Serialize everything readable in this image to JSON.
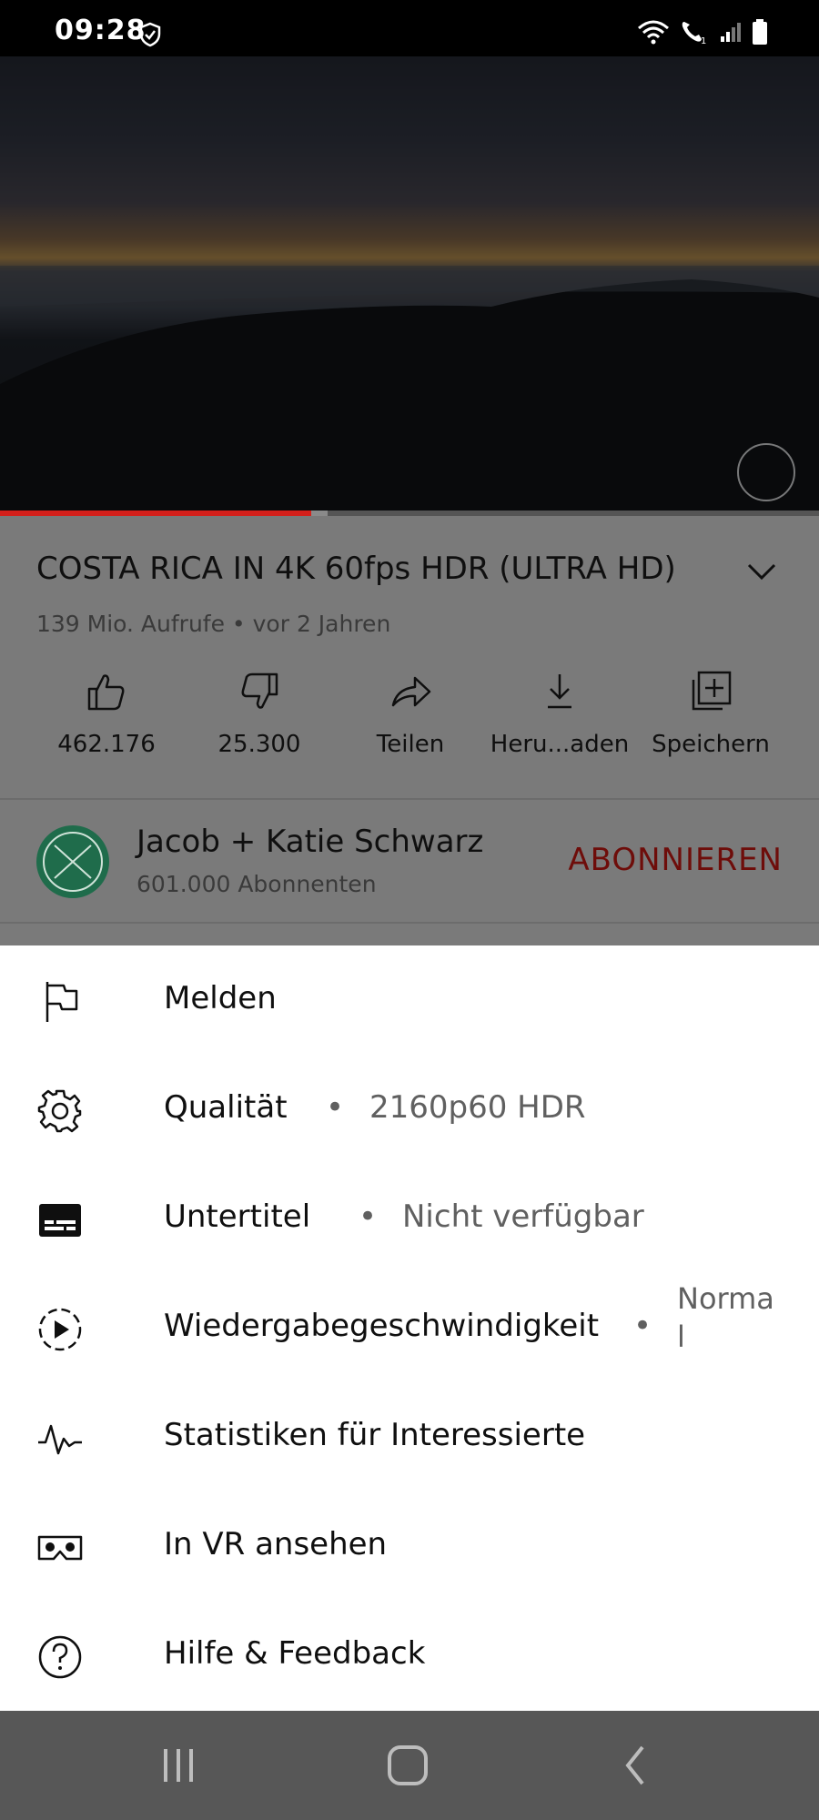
{
  "status_bar": {
    "time": "09:28"
  },
  "video": {
    "progress_played_fraction": 0.38
  },
  "info": {
    "title": "COSTA RICA IN 4K 60fps HDR (ULTRA HD)",
    "meta": "139 Mio. Aufrufe • vor 2 Jahren",
    "actions": [
      {
        "icon": "thumbs-up-icon",
        "label": "462.176"
      },
      {
        "icon": "thumbs-down-icon",
        "label": "25.300"
      },
      {
        "icon": "share-icon",
        "label": "Teilen"
      },
      {
        "icon": "download-icon",
        "label": "Heru...aden"
      },
      {
        "icon": "save-playlist-icon",
        "label": "Speichern"
      }
    ],
    "channel": {
      "name": "Jacob + Katie Schwarz",
      "subscribers": "601.000 Abonnenten",
      "subscribe_label": "ABONNIEREN"
    }
  },
  "menu": [
    {
      "icon": "flag-icon",
      "label": "Melden"
    },
    {
      "icon": "gear-icon",
      "label": "Qualität",
      "separator": "•",
      "value": "2160p60 HDR"
    },
    {
      "icon": "subtitles-icon",
      "label": "Untertitel",
      "separator": "•",
      "value": "Nicht verfügbar"
    },
    {
      "icon": "playback-speed-icon",
      "label": "Wiedergabegeschwindigkeit",
      "separator": "•",
      "value": "Normal"
    },
    {
      "icon": "stats-icon",
      "label": "Statistiken für Interessierte"
    },
    {
      "icon": "vr-headset-icon",
      "label": "In VR ansehen"
    },
    {
      "icon": "help-icon",
      "label": "Hilfe & Feedback"
    }
  ],
  "colors": {
    "progress_played": "#d4201b",
    "subscribe_text": "#6e0d0a",
    "channel_avatar": "#1f6c4b",
    "sheet_background": "#ffffff",
    "navbar_background": "#575757"
  }
}
